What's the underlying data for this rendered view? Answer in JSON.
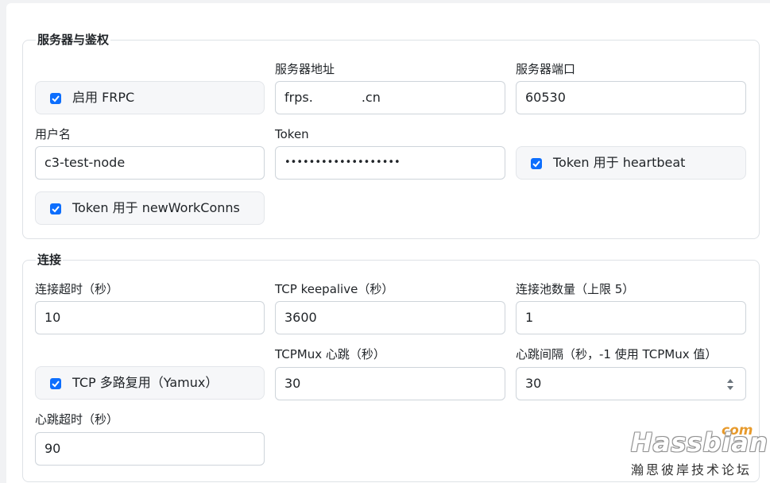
{
  "server_auth": {
    "legend": "服务器与鉴权",
    "enable_frpc": {
      "label": "启用 FRPC",
      "checked": true
    },
    "server_addr": {
      "label": "服务器地址",
      "value": "frps.            .cn"
    },
    "server_port": {
      "label": "服务器端口",
      "value": "60530"
    },
    "username": {
      "label": "用户名",
      "value": "c3-test-node"
    },
    "token": {
      "label": "Token",
      "value": "•••••••••••••••••••"
    },
    "token_heartbeat": {
      "label": "Token 用于 heartbeat",
      "checked": true
    },
    "token_newworkconns": {
      "label": "Token 用于 newWorkConns",
      "checked": true
    }
  },
  "connection": {
    "legend": "连接",
    "conn_timeout": {
      "label": "连接超时（秒）",
      "value": "10"
    },
    "tcp_keepalive": {
      "label": "TCP keepalive（秒）",
      "value": "3600"
    },
    "pool_count": {
      "label": "连接池数量（上限 5）",
      "value": "1"
    },
    "tcp_mux": {
      "label": "TCP 多路复用（Yamux）",
      "checked": true
    },
    "tcpmux_heartbeat": {
      "label": "TCPMux 心跳（秒）",
      "value": "30"
    },
    "heartbeat_interval": {
      "label": "心跳间隔（秒，-1 使用 TCPMux 值）",
      "value": "30"
    },
    "heartbeat_timeout": {
      "label": "心跳超时（秒）",
      "value": "90"
    }
  },
  "watermark": {
    "name": "Hassbian",
    "suffix": "com",
    "subtitle": "瀚思彼岸技术论坛"
  },
  "colors": {
    "accent": "#0d6efd",
    "border": "#ced4da"
  }
}
